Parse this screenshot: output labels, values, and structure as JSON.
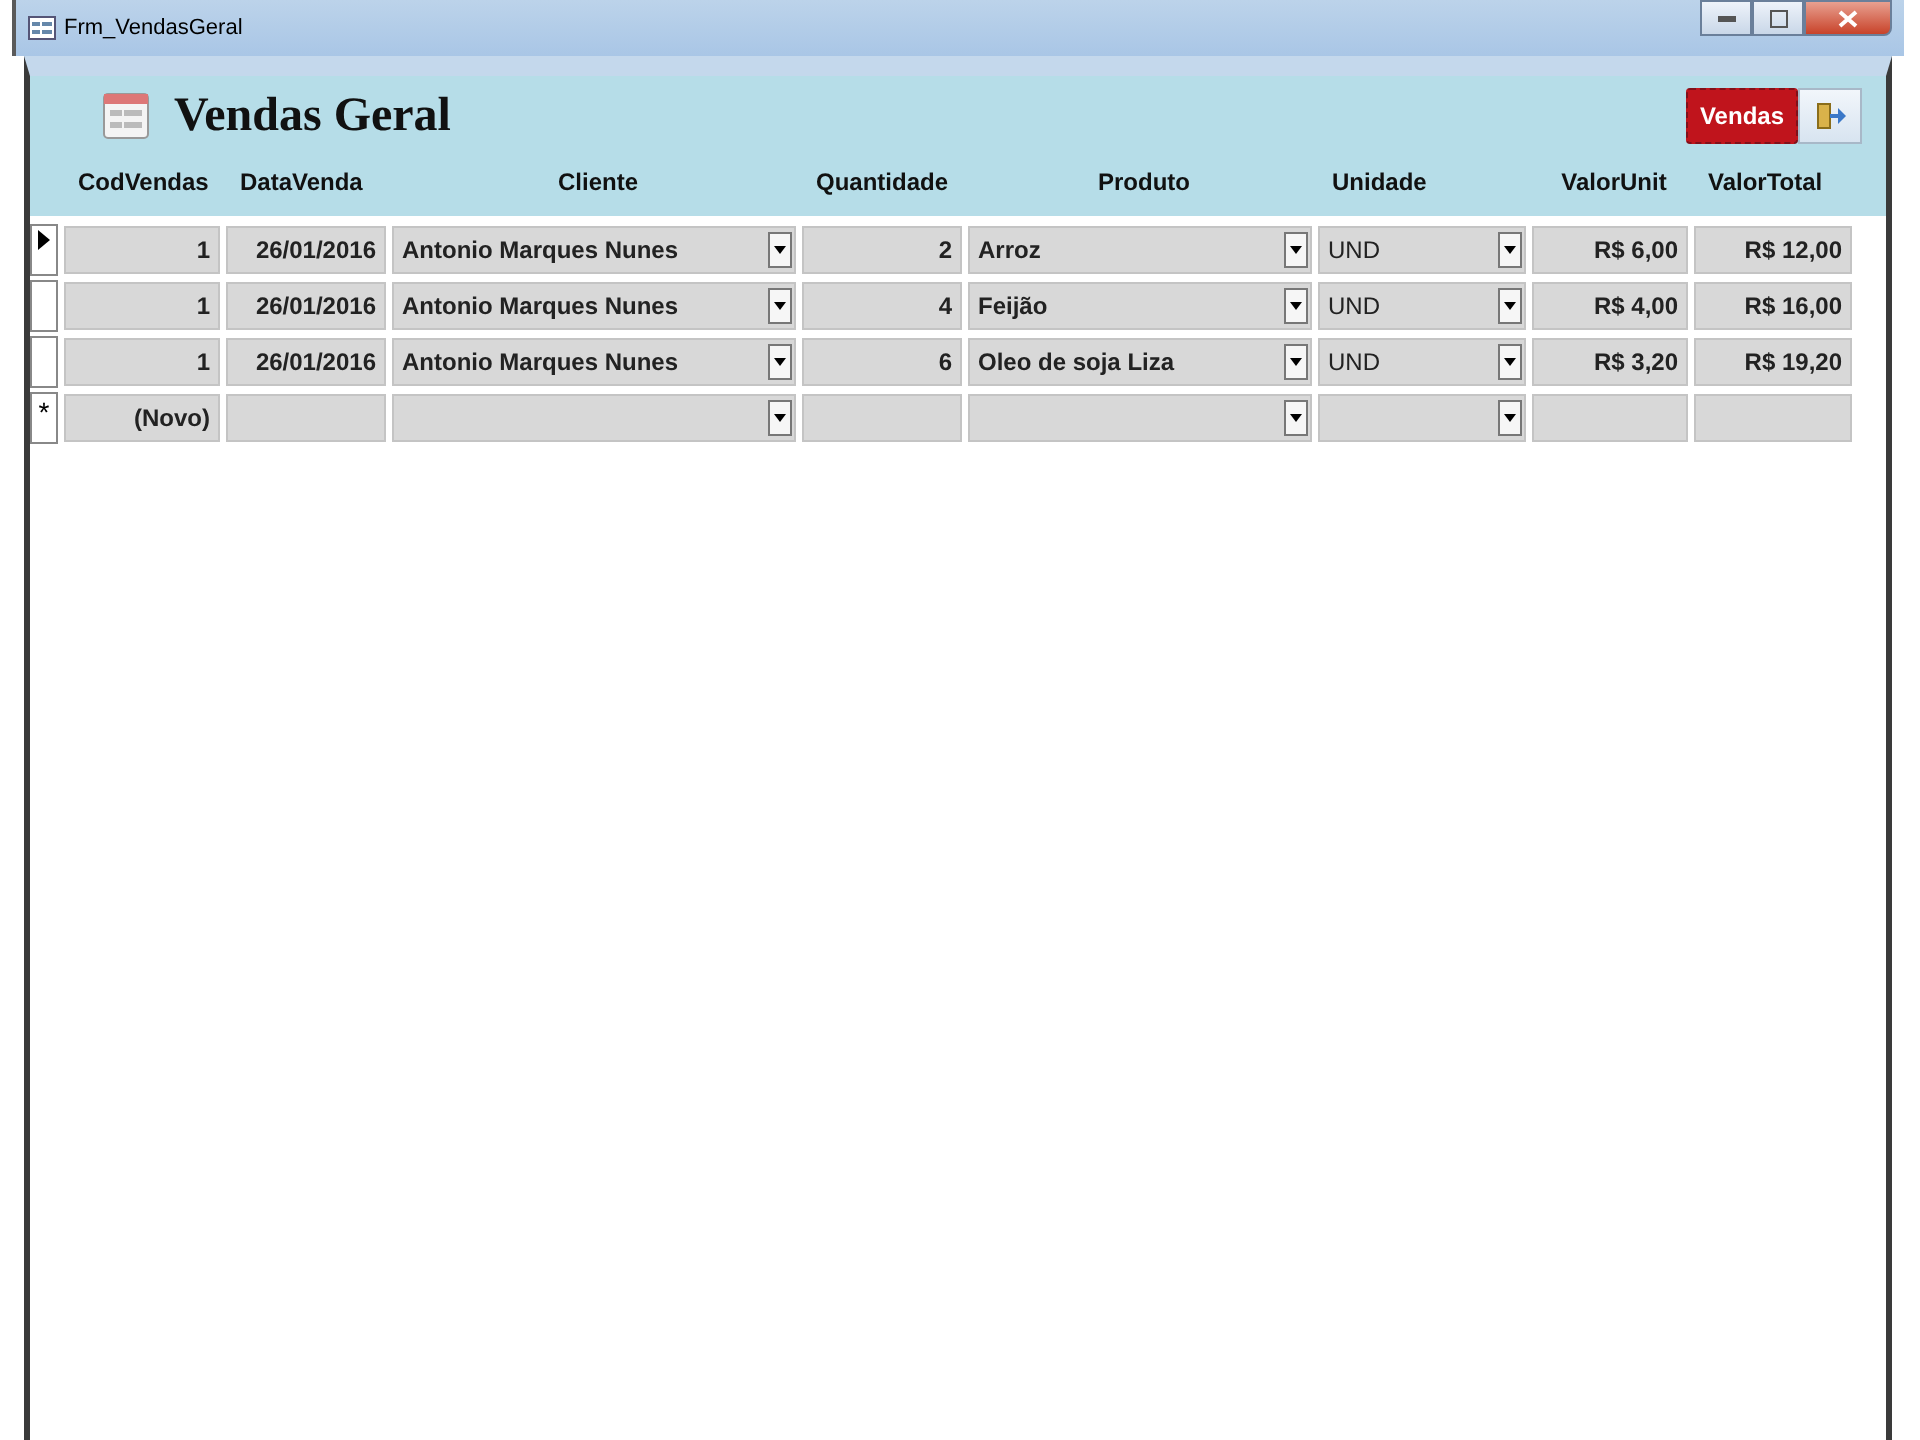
{
  "window": {
    "title": "Frm_VendasGeral"
  },
  "header": {
    "title": "Vendas Geral",
    "vendas_button": "Vendas"
  },
  "columns": [
    {
      "label": "CodVendas"
    },
    {
      "label": "DataVenda"
    },
    {
      "label": "Cliente"
    },
    {
      "label": "Quantidade"
    },
    {
      "label": "Produto"
    },
    {
      "label": "Unidade"
    },
    {
      "label": "ValorUnit"
    },
    {
      "label": "ValorTotal"
    }
  ],
  "rows": [
    {
      "selected": true,
      "cod": "1",
      "data": "26/01/2016",
      "cliente": "Antonio Marques Nunes",
      "quantidade": "2",
      "produto": "Arroz",
      "unidade": "UND",
      "valor_unit": "R$ 6,00",
      "valor_total": "R$ 12,00"
    },
    {
      "selected": false,
      "cod": "1",
      "data": "26/01/2016",
      "cliente": "Antonio Marques Nunes",
      "quantidade": "4",
      "produto": "Feijão",
      "unidade": "UND",
      "valor_unit": "R$ 4,00",
      "valor_total": "R$ 16,00"
    },
    {
      "selected": false,
      "cod": "1",
      "data": "26/01/2016",
      "cliente": "Antonio Marques Nunes",
      "quantidade": "6",
      "produto": "Oleo de soja Liza",
      "unidade": "UND",
      "valor_unit": "R$ 3,20",
      "valor_total": "R$ 19,20"
    }
  ],
  "new_row": {
    "marker": "*",
    "cod": "(Novo)"
  }
}
